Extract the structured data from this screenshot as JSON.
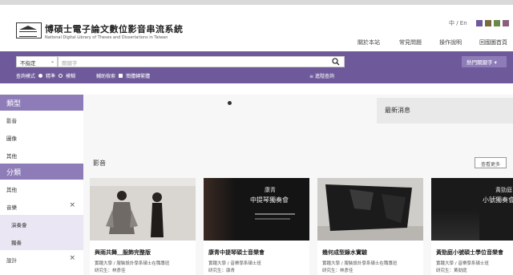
{
  "header": {
    "title": "博碩士電子論文數位影音串流系統",
    "subtitle": "National Digital Library of Theses and Dissertations in Taiwan",
    "lang_toggle": "中 / En",
    "theme_colors": [
      "#6e5a9a",
      "#7a6a3e",
      "#6b8a4a",
      "#8a5f7c"
    ],
    "nav": [
      "關於本站",
      "常見問題",
      "操作說明",
      "回國圖首頁"
    ]
  },
  "search": {
    "scope": "不指定",
    "placeholder": "關鍵字",
    "hot_keywords": "熱門關鍵字 ▾",
    "mode_label": "查詢模式",
    "mode_exact": "精準",
    "mode_fuzzy": "模糊",
    "assist_label": "輔助檢索",
    "simp_trad": "簡體轉繁體",
    "advanced": "進階查詢"
  },
  "sidebar": {
    "type_header": "類型",
    "type_items": [
      "影音",
      "圖像",
      "其他"
    ],
    "category_header": "分類",
    "category_items": [
      {
        "label": "其他",
        "sub": false,
        "removable": false
      },
      {
        "label": "音樂",
        "sub": false,
        "removable": true
      },
      {
        "label": "演奏會",
        "sub": true,
        "removable": false
      },
      {
        "label": "獨奏",
        "sub": true,
        "removable": false
      },
      {
        "label": "設計",
        "sub": false,
        "removable": true
      }
    ]
  },
  "main": {
    "news_title": "最新消息",
    "section_label": "影音",
    "more_button": "查看更多",
    "cards": [
      {
        "title": "與雨共舞＿服飾完整版",
        "meta1": "實踐大學 / 服裝設計學系碩士在職專班",
        "meta2": "研究生：林彥佳"
      },
      {
        "title": "康青中提琴碩士音樂會",
        "meta1": "實踐大學 / 音樂學系碩士班",
        "meta2": "研究生：康青"
      },
      {
        "title": "幾何成型錄水實驗",
        "meta1": "實踐大學 / 服裝設計學系碩士在職專班",
        "meta2": "研究生：林彥佳"
      },
      {
        "title": "黃勁庭小號碩士學位音樂會",
        "meta1": "實踐大學 / 音樂學系碩士班",
        "meta2": "研究生：黃勁庭"
      }
    ],
    "poster2_line1": "康青",
    "poster2_line2": "中提琴獨奏會",
    "poster4_line1": "黃勁庭",
    "poster4_line2": "小號獨奏會"
  }
}
